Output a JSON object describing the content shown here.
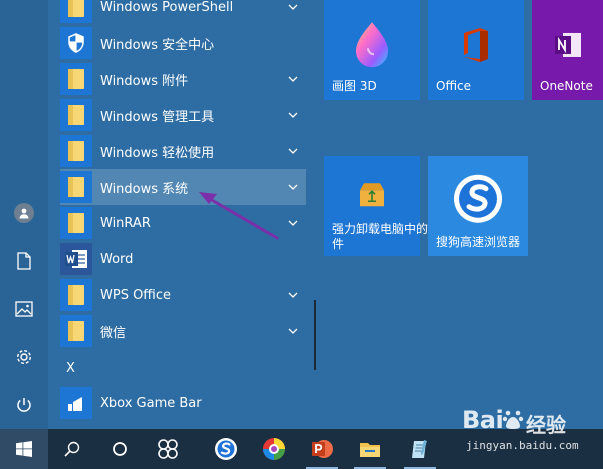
{
  "apps": [
    {
      "label": "Windows PowerShell",
      "icon": "folder-icon",
      "expandable": true
    },
    {
      "label": "Windows 安全中心",
      "icon": "shield-icon",
      "expandable": false
    },
    {
      "label": "Windows 附件",
      "icon": "folder-icon",
      "expandable": true
    },
    {
      "label": "Windows 管理工具",
      "icon": "folder-icon",
      "expandable": true
    },
    {
      "label": "Windows 轻松使用",
      "icon": "folder-icon",
      "expandable": true
    },
    {
      "label": "Windows 系统",
      "icon": "folder-icon",
      "expandable": true,
      "selected": true
    },
    {
      "label": "WinRAR",
      "icon": "folder-icon",
      "expandable": true
    },
    {
      "label": "Word",
      "icon": "word-icon",
      "expandable": false
    },
    {
      "label": "WPS Office",
      "icon": "folder-icon",
      "expandable": true
    },
    {
      "label": "微信",
      "icon": "folder-icon",
      "expandable": true
    }
  ],
  "section_letter": "X",
  "xbox_app": {
    "label": "Xbox Game Bar",
    "icon": "xbox-icon"
  },
  "tiles": {
    "paint3d": {
      "label": "画图 3D",
      "icon": "paint3d-icon"
    },
    "office": {
      "label": "Office",
      "icon": "office-icon"
    },
    "onenote": {
      "label": "OneNote",
      "icon": "onenote-icon"
    },
    "uninstall": {
      "label": "强力卸载电脑中的软件",
      "icon": "uninstall-box-icon"
    },
    "sogou": {
      "label": "搜狗高速浏览器",
      "icon": "sogou-browser-icon"
    }
  },
  "rail_icons": [
    "user-avatar-icon",
    "document-icon",
    "pictures-icon",
    "settings-icon",
    "power-icon"
  ],
  "taskbar_icons": [
    "windows-start-icon",
    "search-icon",
    "cortana-icon",
    "task-view-icon",
    "sogou-browser-icon",
    "chrome-colorful-icon",
    "powerpoint-icon",
    "file-explorer-icon",
    "notepad-icon"
  ],
  "colors": {
    "accent": "#1d76d4",
    "desktop": "#2d6da3",
    "taskbar": "#1b2f42",
    "onenote": "#7719aa",
    "arrow": "#7b2fa8"
  },
  "watermark": {
    "brand": "Bai",
    "suffix": "经验",
    "url": "jingyan.baidu.com"
  }
}
